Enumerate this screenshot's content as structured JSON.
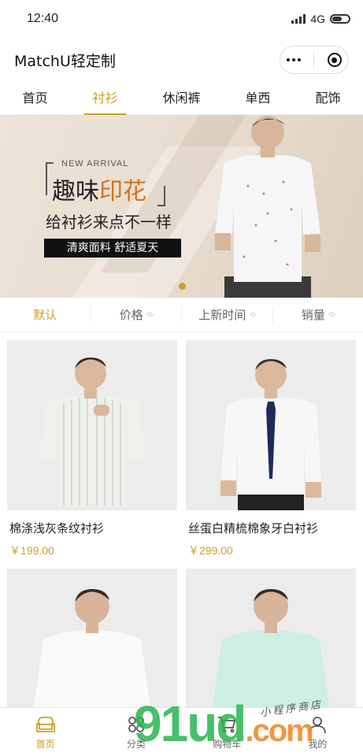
{
  "status": {
    "time": "12:40",
    "network": "4G"
  },
  "nav": {
    "title": "MatchU轻定制"
  },
  "categories": [
    {
      "label": "首页",
      "active": false
    },
    {
      "label": "衬衫",
      "active": true
    },
    {
      "label": "休闲裤",
      "active": false
    },
    {
      "label": "单西",
      "active": false
    },
    {
      "label": "配饰",
      "active": false
    }
  ],
  "banner": {
    "eyebrow": "NEW ARRIVAL",
    "headline_a": "趣味",
    "headline_b": "印花",
    "subtitle": "给衬衫来点不一样",
    "tag": "清爽面料 舒适夏天"
  },
  "sort": [
    {
      "label": "默认",
      "active": true
    },
    {
      "label": "价格",
      "active": false
    },
    {
      "label": "上新时间",
      "active": false
    },
    {
      "label": "销量",
      "active": false
    }
  ],
  "products": [
    {
      "name": "棉涤浅灰条纹衬衫",
      "price": "￥199.00",
      "shirt_color": "#eef0ec"
    },
    {
      "name": "丝蛋白精梳棉象牙白衬衫",
      "price": "￥299.00",
      "shirt_color": "#f7f7f7"
    },
    {
      "name": "",
      "price": "",
      "shirt_color": "#fafafa"
    },
    {
      "name": "",
      "price": "",
      "shirt_color": "#cdeee5"
    }
  ],
  "tabbar": [
    {
      "label": "首页",
      "icon": "sofa-icon",
      "active": true
    },
    {
      "label": "分类",
      "icon": "grid-icon",
      "active": false
    },
    {
      "label": "购物车",
      "icon": "cart-icon",
      "active": false
    },
    {
      "label": "我的",
      "icon": "user-icon",
      "active": false
    }
  ],
  "watermark": {
    "brand": "91ud",
    "suffix": ".com",
    "caption": "小程序商店"
  },
  "colors": {
    "accent": "#c9a227",
    "banner_highlight": "#d6711c"
  }
}
